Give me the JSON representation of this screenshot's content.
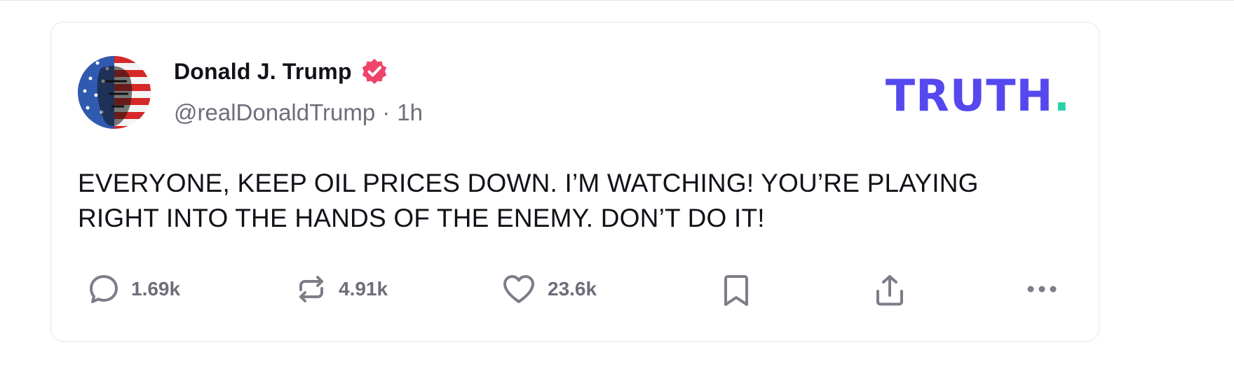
{
  "post": {
    "author": {
      "display_name": "Donald J. Trump",
      "handle": "@realDonaldTrump",
      "verified_icon": "verified-badge-icon",
      "badge_color": "#f0436a"
    },
    "separator": "·",
    "timestamp": "1h",
    "text": "EVERYONE, KEEP OIL PRICES DOWN. I’M WATCHING! YOU’RE PLAYING RIGHT INTO THE HANDS OF THE ENEMY. DON’T DO IT!"
  },
  "brand": {
    "wordmark": "TRUTH",
    "dot": ".",
    "color": "#5448ee",
    "dot_color": "#2bd1a8"
  },
  "actions": {
    "reply": {
      "icon": "reply-icon",
      "count": "1.69k"
    },
    "retruth": {
      "icon": "retruth-icon",
      "count": "4.91k"
    },
    "like": {
      "icon": "heart-icon",
      "count": "23.6k"
    },
    "bookmark": {
      "icon": "bookmark-icon"
    },
    "share": {
      "icon": "share-icon"
    },
    "more": {
      "icon": "more-icon"
    }
  }
}
